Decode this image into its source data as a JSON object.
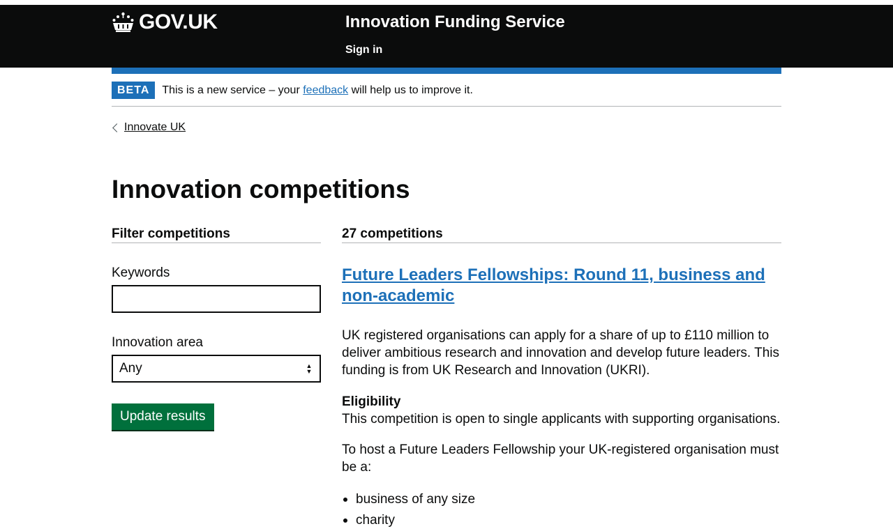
{
  "header": {
    "logo_text": "GOV.UK",
    "service_name": "Innovation Funding Service",
    "sign_in": "Sign in"
  },
  "phase_banner": {
    "tag": "BETA",
    "text_before": "This is a new service – your ",
    "link": "feedback",
    "text_after": " will help us to improve it."
  },
  "breadcrumb": {
    "link": "Innovate UK"
  },
  "page_title": "Innovation competitions",
  "filter": {
    "title": "Filter competitions",
    "keywords_label": "Keywords",
    "keywords_value": "",
    "innovation_area_label": "Innovation area",
    "innovation_area_value": "Any",
    "update_button": "Update results"
  },
  "results": {
    "count": "27 competitions",
    "competition": {
      "title": "Future Leaders Fellowships: Round 11, business and non-academic",
      "description": "UK registered organisations can apply for a share of up to £110 million to deliver ambitious research and innovation and develop future leaders. This funding is from UK Research and Innovation (UKRI).",
      "eligibility_heading": "Eligibility",
      "eligibility_text": "This competition is open to single applicants with supporting organisations.",
      "host_text": "To host a Future Leaders Fellowship your UK-registered organisation must be a:",
      "bullets": [
        "business of any size",
        "charity"
      ]
    }
  },
  "colors": {
    "header_bg": "#0b0c0c",
    "brand_blue": "#1d70b8",
    "button_green": "#00703c"
  }
}
